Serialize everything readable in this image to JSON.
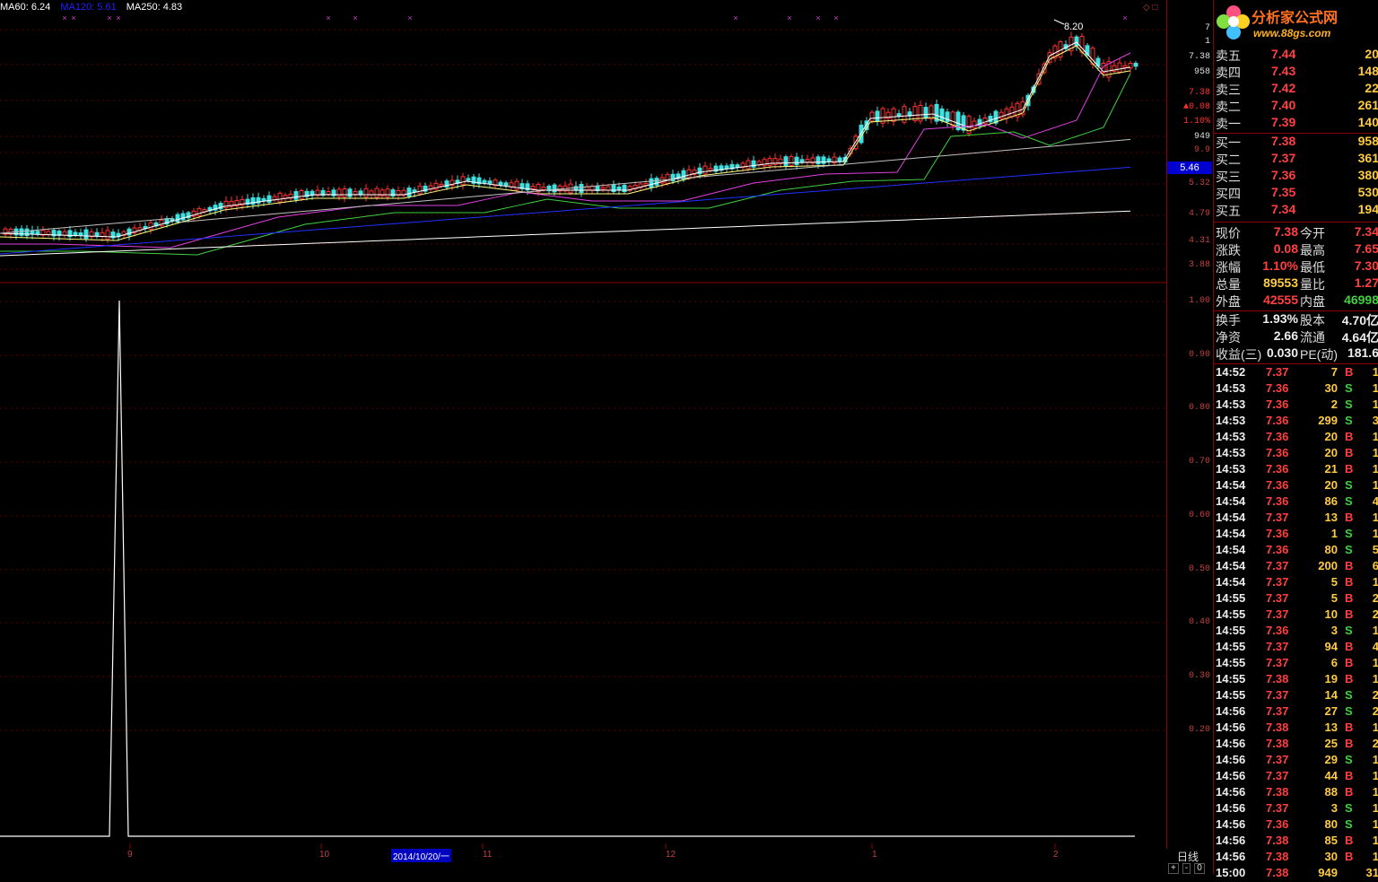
{
  "ma_legend": [
    {
      "label": "MA60: 6.24",
      "color": "#ffffff"
    },
    {
      "label": "MA120: 5.61",
      "color": "#2020ff"
    },
    {
      "label": "MA250: 4.83",
      "color": "#ffffff"
    }
  ],
  "chart_marks": {
    "peak_label": "8.20"
  },
  "price_axis": {
    "labels": [
      "7",
      "1",
      "7.38",
      "958",
      "7.38",
      "▲0.08",
      "1.10%",
      "949",
      "9.9",
      "5.46",
      "5.32",
      "4.79",
      "4.31",
      "3.88"
    ],
    "current_price": "5.46"
  },
  "indicator_axis": {
    "labels": [
      "1.00",
      "0.90",
      "0.80",
      "0.70",
      "0.60",
      "0.50",
      "0.40",
      "0.30",
      "0.20"
    ]
  },
  "date_bar": {
    "ticks": [
      "9",
      "10",
      "11",
      "12",
      "1",
      "2"
    ],
    "selected": "2014/10/20/一"
  },
  "controls": {
    "period": "日线",
    "plus": "+",
    "minus": "-",
    "zero": "0"
  },
  "corner_icons": "◇ □",
  "logo": {
    "title": "分析家公式网",
    "url": "www.88gs.com"
  },
  "order_book": {
    "asks": [
      {
        "label": "卖五",
        "price": "7.44",
        "volume": "20"
      },
      {
        "label": "卖四",
        "price": "7.43",
        "volume": "148"
      },
      {
        "label": "卖三",
        "price": "7.42",
        "volume": "22"
      },
      {
        "label": "卖二",
        "price": "7.40",
        "volume": "261"
      },
      {
        "label": "卖一",
        "price": "7.39",
        "volume": "140"
      }
    ],
    "bids": [
      {
        "label": "买一",
        "price": "7.38",
        "volume": "958"
      },
      {
        "label": "买二",
        "price": "7.37",
        "volume": "361"
      },
      {
        "label": "买三",
        "price": "7.36",
        "volume": "380"
      },
      {
        "label": "买四",
        "price": "7.35",
        "volume": "530"
      },
      {
        "label": "买五",
        "price": "7.34",
        "volume": "194"
      }
    ]
  },
  "quote": [
    {
      "l1": "现价",
      "v1": "7.38",
      "c1": "red",
      "l2": "今开",
      "v2": "7.34",
      "c2": "red"
    },
    {
      "l1": "涨跌",
      "v1": "0.08",
      "c1": "red",
      "l2": "最高",
      "v2": "7.65",
      "c2": "red"
    },
    {
      "l1": "涨幅",
      "v1": "1.10%",
      "c1": "red",
      "l2": "最低",
      "v2": "7.30",
      "c2": "red"
    },
    {
      "l1": "总量",
      "v1": "89553",
      "c1": "yellow",
      "l2": "量比",
      "v2": "1.27",
      "c2": "red"
    },
    {
      "l1": "外盘",
      "v1": "42555",
      "c1": "red",
      "l2": "内盘",
      "v2": "46998",
      "c2": "green"
    },
    {
      "l1": "换手",
      "v1": "1.93%",
      "c1": "white",
      "l2": "股本",
      "v2": "4.70亿",
      "c2": "white"
    },
    {
      "l1": "净资",
      "v1": "2.66",
      "c1": "white",
      "l2": "流通",
      "v2": "4.64亿",
      "c2": "white"
    },
    {
      "l1": "收益(三)",
      "v1": "0.030",
      "c1": "white",
      "l2": "PE(动)",
      "v2": "181.6",
      "c2": "white"
    }
  ],
  "ticks": [
    {
      "time": "14:52",
      "price": "7.37",
      "vol": "7",
      "bs": "B",
      "n": "1"
    },
    {
      "time": "14:53",
      "price": "7.36",
      "vol": "30",
      "bs": "S",
      "n": "1"
    },
    {
      "time": "14:53",
      "price": "7.36",
      "vol": "2",
      "bs": "S",
      "n": "1"
    },
    {
      "time": "14:53",
      "price": "7.36",
      "vol": "299",
      "bs": "S",
      "n": "3"
    },
    {
      "time": "14:53",
      "price": "7.36",
      "vol": "20",
      "bs": "B",
      "n": "1"
    },
    {
      "time": "14:53",
      "price": "7.36",
      "vol": "20",
      "bs": "B",
      "n": "1"
    },
    {
      "time": "14:53",
      "price": "7.36",
      "vol": "21",
      "bs": "B",
      "n": "1"
    },
    {
      "time": "14:54",
      "price": "7.36",
      "vol": "20",
      "bs": "S",
      "n": "1"
    },
    {
      "time": "14:54",
      "price": "7.36",
      "vol": "86",
      "bs": "S",
      "n": "4"
    },
    {
      "time": "14:54",
      "price": "7.37",
      "vol": "13",
      "bs": "B",
      "n": "1"
    },
    {
      "time": "14:54",
      "price": "7.36",
      "vol": "1",
      "bs": "S",
      "n": "1"
    },
    {
      "time": "14:54",
      "price": "7.36",
      "vol": "80",
      "bs": "S",
      "n": "5"
    },
    {
      "time": "14:54",
      "price": "7.37",
      "vol": "200",
      "bs": "B",
      "n": "6"
    },
    {
      "time": "14:54",
      "price": "7.37",
      "vol": "5",
      "bs": "B",
      "n": "1"
    },
    {
      "time": "14:55",
      "price": "7.37",
      "vol": "5",
      "bs": "B",
      "n": "2"
    },
    {
      "time": "14:55",
      "price": "7.37",
      "vol": "10",
      "bs": "B",
      "n": "2"
    },
    {
      "time": "14:55",
      "price": "7.36",
      "vol": "3",
      "bs": "S",
      "n": "1"
    },
    {
      "time": "14:55",
      "price": "7.37",
      "vol": "94",
      "bs": "B",
      "n": "4"
    },
    {
      "time": "14:55",
      "price": "7.37",
      "vol": "6",
      "bs": "B",
      "n": "1"
    },
    {
      "time": "14:55",
      "price": "7.38",
      "vol": "19",
      "bs": "B",
      "n": "1"
    },
    {
      "time": "14:55",
      "price": "7.37",
      "vol": "14",
      "bs": "S",
      "n": "2"
    },
    {
      "time": "14:56",
      "price": "7.37",
      "vol": "27",
      "bs": "S",
      "n": "2"
    },
    {
      "time": "14:56",
      "price": "7.38",
      "vol": "13",
      "bs": "B",
      "n": "1"
    },
    {
      "time": "14:56",
      "price": "7.38",
      "vol": "25",
      "bs": "B",
      "n": "2"
    },
    {
      "time": "14:56",
      "price": "7.37",
      "vol": "29",
      "bs": "S",
      "n": "1"
    },
    {
      "time": "14:56",
      "price": "7.37",
      "vol": "44",
      "bs": "B",
      "n": "1"
    },
    {
      "time": "14:56",
      "price": "7.38",
      "vol": "88",
      "bs": "B",
      "n": "1"
    },
    {
      "time": "14:56",
      "price": "7.37",
      "vol": "3",
      "bs": "S",
      "n": "1"
    },
    {
      "time": "14:56",
      "price": "7.36",
      "vol": "80",
      "bs": "S",
      "n": "1"
    },
    {
      "time": "14:56",
      "price": "7.38",
      "vol": "85",
      "bs": "B",
      "n": "1"
    },
    {
      "time": "14:56",
      "price": "7.38",
      "vol": "30",
      "bs": "B",
      "n": "1"
    },
    {
      "time": "15:00",
      "price": "7.38",
      "vol": "949",
      "bs": "",
      "n": "31",
      "volColor": "purple"
    }
  ]
}
